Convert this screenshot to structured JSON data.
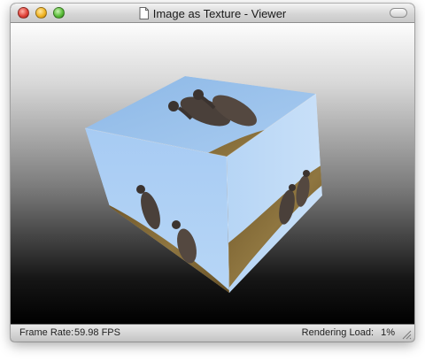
{
  "window": {
    "title": "Image as Texture - Viewer",
    "title_icon": "document-icon"
  },
  "viewport": {
    "subject": "rotating cube textured with vultures on a branch against blue sky",
    "colors": {
      "sky": "#9cc4ee",
      "branch": "#7c6532",
      "bird": "#4a403a",
      "background_top": "#fdfdfd",
      "background_bottom": "#000000"
    }
  },
  "status": {
    "frame_rate_label": "Frame Rate:",
    "frame_rate_value": "59.98 FPS",
    "rendering_load_label": "Rendering Load:",
    "rendering_load_value": "1%"
  }
}
